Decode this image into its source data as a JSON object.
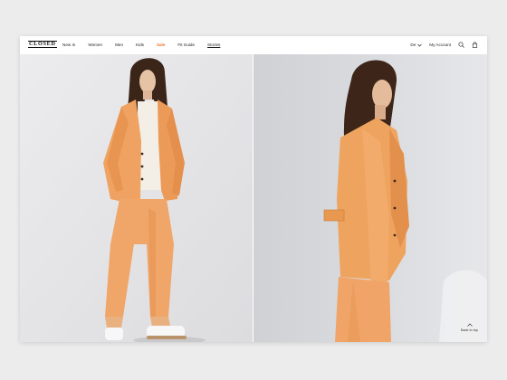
{
  "brand": {
    "logo_text": "CLOSED"
  },
  "nav": {
    "items": [
      {
        "label": "New In",
        "color": "#222222"
      },
      {
        "label": "Women",
        "color": "#222222"
      },
      {
        "label": "Men",
        "color": "#222222"
      },
      {
        "label": "Kids",
        "color": "#222222"
      },
      {
        "label": "Sale",
        "color": "#e8762c"
      },
      {
        "label": "Fit Guide",
        "color": "#222222"
      },
      {
        "label": "Stories",
        "color": "#222222"
      }
    ],
    "language": "De",
    "account": "My Account",
    "icons": [
      "chevron-down-icon",
      "search-icon",
      "shopping-bag-icon"
    ]
  },
  "footer": {
    "back_to_top": "Back to top"
  },
  "colors": {
    "accent_sale": "#e8762c",
    "outfit_orange": "#f0a465",
    "background": "#ececec"
  }
}
